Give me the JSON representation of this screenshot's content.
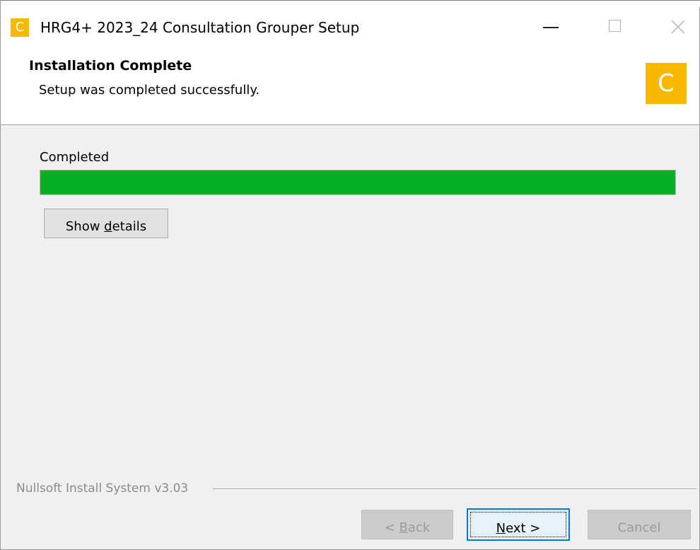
{
  "window": {
    "title": "HRG4+ 2023_24 Consultation Grouper Setup",
    "icon_letter": "C",
    "icon_color": "#f6b800"
  },
  "header": {
    "title": "Installation Complete",
    "subtitle": "Setup was completed successfully.",
    "logo_letter": "C",
    "logo_color": "#f6b800"
  },
  "content": {
    "status_label": "Completed",
    "progress_percent": 100,
    "progress_color": "#06b025",
    "show_details_before": "Show ",
    "show_details_accel": "d",
    "show_details_after": "etails"
  },
  "footer": {
    "branding": "Nullsoft Install System v3.03",
    "back_prefix": "< ",
    "back_accel": "B",
    "back_rest": "ack",
    "next_accel": "N",
    "next_rest": "ext >",
    "cancel_label": "Cancel"
  },
  "icons": {
    "minimize": "minimize-icon",
    "maximize": "maximize-icon",
    "close": "close-icon"
  }
}
